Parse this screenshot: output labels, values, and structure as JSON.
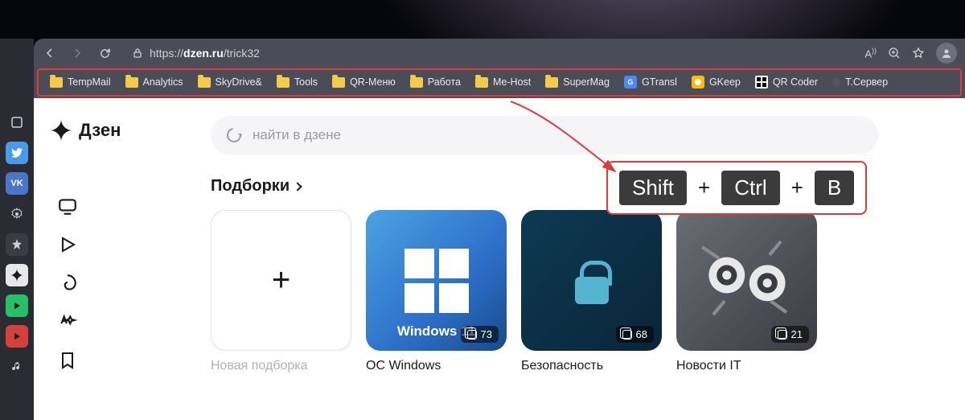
{
  "url": {
    "scheme": "https://",
    "host": "dzen.ru",
    "path": "/trick32"
  },
  "bookmarks": [
    {
      "label": "TempMail",
      "type": "folder"
    },
    {
      "label": "Analytics",
      "type": "folder"
    },
    {
      "label": "SkyDrive&",
      "type": "folder"
    },
    {
      "label": "Tools",
      "type": "folder"
    },
    {
      "label": "QR-Меню",
      "type": "folder"
    },
    {
      "label": "Работа",
      "type": "folder"
    },
    {
      "label": "Me-Host",
      "type": "folder"
    },
    {
      "label": "SuperMag",
      "type": "folder"
    },
    {
      "label": "GTransl",
      "type": "g"
    },
    {
      "label": "GKeep",
      "type": "keep"
    },
    {
      "label": "QR Coder",
      "type": "qr"
    },
    {
      "label": "Т.Сервер",
      "type": "dot"
    }
  ],
  "brand": "Дзен",
  "search_placeholder": "найти в дзене",
  "section_title": "Подборки",
  "cards": [
    {
      "title": "Новая подборка",
      "count": null,
      "kind": "add"
    },
    {
      "title": "OC Windows",
      "count": "73",
      "kind": "win",
      "caption": "Windows 11"
    },
    {
      "title": "Безопасность",
      "count": "68",
      "kind": "sec"
    },
    {
      "title": "Новости IT",
      "count": "21",
      "kind": "news"
    }
  ],
  "shortcut": [
    "Shift",
    "+",
    "Ctrl",
    "+",
    "B"
  ]
}
